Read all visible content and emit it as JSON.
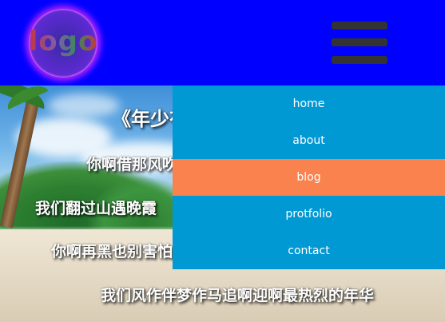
{
  "header": {
    "logo_text": "logo",
    "menu_icon": "hamburger-menu-icon",
    "background_color": "#0000ff"
  },
  "nav": {
    "background_color": "#0099d4",
    "active_color": "#f9824f",
    "items": [
      {
        "label": "home",
        "active": false
      },
      {
        "label": "about",
        "active": false
      },
      {
        "label": "blog",
        "active": true
      },
      {
        "label": "protfolio",
        "active": false
      },
      {
        "label": "contact",
        "active": false
      }
    ]
  },
  "hero": {
    "lines": [
      "《年少有为》",
      "你啊借那风吹走灰",
      "我们翻过山遇晚霞",
      "你啊再黑也别害怕",
      "我们风作伴梦作马追啊迎啊最热烈的年华"
    ]
  }
}
